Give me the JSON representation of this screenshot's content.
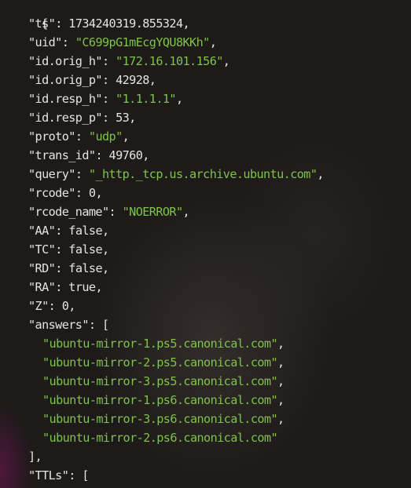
{
  "json_view": {
    "open_brace": "{",
    "fields": [
      {
        "key": "\"ts\"",
        "value": "1734240319.855324",
        "type": "num",
        "comma": ","
      },
      {
        "key": "\"uid\"",
        "value": "\"C699pG1mEcgYQU8KKh\"",
        "type": "str",
        "comma": ","
      },
      {
        "key": "\"id.orig_h\"",
        "value": "\"172.16.101.156\"",
        "type": "str",
        "comma": ","
      },
      {
        "key": "\"id.orig_p\"",
        "value": "42928",
        "type": "num",
        "comma": ","
      },
      {
        "key": "\"id.resp_h\"",
        "value": "\"1.1.1.1\"",
        "type": "str",
        "comma": ","
      },
      {
        "key": "\"id.resp_p\"",
        "value": "53",
        "type": "num",
        "comma": ","
      },
      {
        "key": "\"proto\"",
        "value": "\"udp\"",
        "type": "str",
        "comma": ","
      },
      {
        "key": "\"trans_id\"",
        "value": "49760",
        "type": "num",
        "comma": ","
      },
      {
        "key": "\"query\"",
        "value": "\"_http._tcp.us.archive.ubuntu.com\"",
        "type": "str",
        "comma": ","
      },
      {
        "key": "\"rcode\"",
        "value": "0",
        "type": "num",
        "comma": ","
      },
      {
        "key": "\"rcode_name\"",
        "value": "\"NOERROR\"",
        "type": "str",
        "comma": ","
      },
      {
        "key": "\"AA\"",
        "value": "false",
        "type": "num",
        "comma": ","
      },
      {
        "key": "\"TC\"",
        "value": "false",
        "type": "num",
        "comma": ","
      },
      {
        "key": "\"RD\"",
        "value": "false",
        "type": "num",
        "comma": ","
      },
      {
        "key": "\"RA\"",
        "value": "true",
        "type": "num",
        "comma": ","
      },
      {
        "key": "\"Z\"",
        "value": "0",
        "type": "num",
        "comma": ","
      }
    ],
    "answers_key": "\"answers\"",
    "answers_open": "[",
    "answers": [
      {
        "value": "\"ubuntu-mirror-1.ps5.canonical.com\"",
        "comma": ","
      },
      {
        "value": "\"ubuntu-mirror-2.ps5.canonical.com\"",
        "comma": ","
      },
      {
        "value": "\"ubuntu-mirror-3.ps5.canonical.com\"",
        "comma": ","
      },
      {
        "value": "\"ubuntu-mirror-1.ps6.canonical.com\"",
        "comma": ","
      },
      {
        "value": "\"ubuntu-mirror-3.ps6.canonical.com\"",
        "comma": ","
      },
      {
        "value": "\"ubuntu-mirror-2.ps6.canonical.com\"",
        "comma": ""
      }
    ],
    "answers_close": "],",
    "ttls_key": "\"TTLs\"",
    "ttls_open": "["
  },
  "colors": {
    "background": "#1d1a19",
    "string": "#7fc34a",
    "text": "#e6e4e1"
  }
}
